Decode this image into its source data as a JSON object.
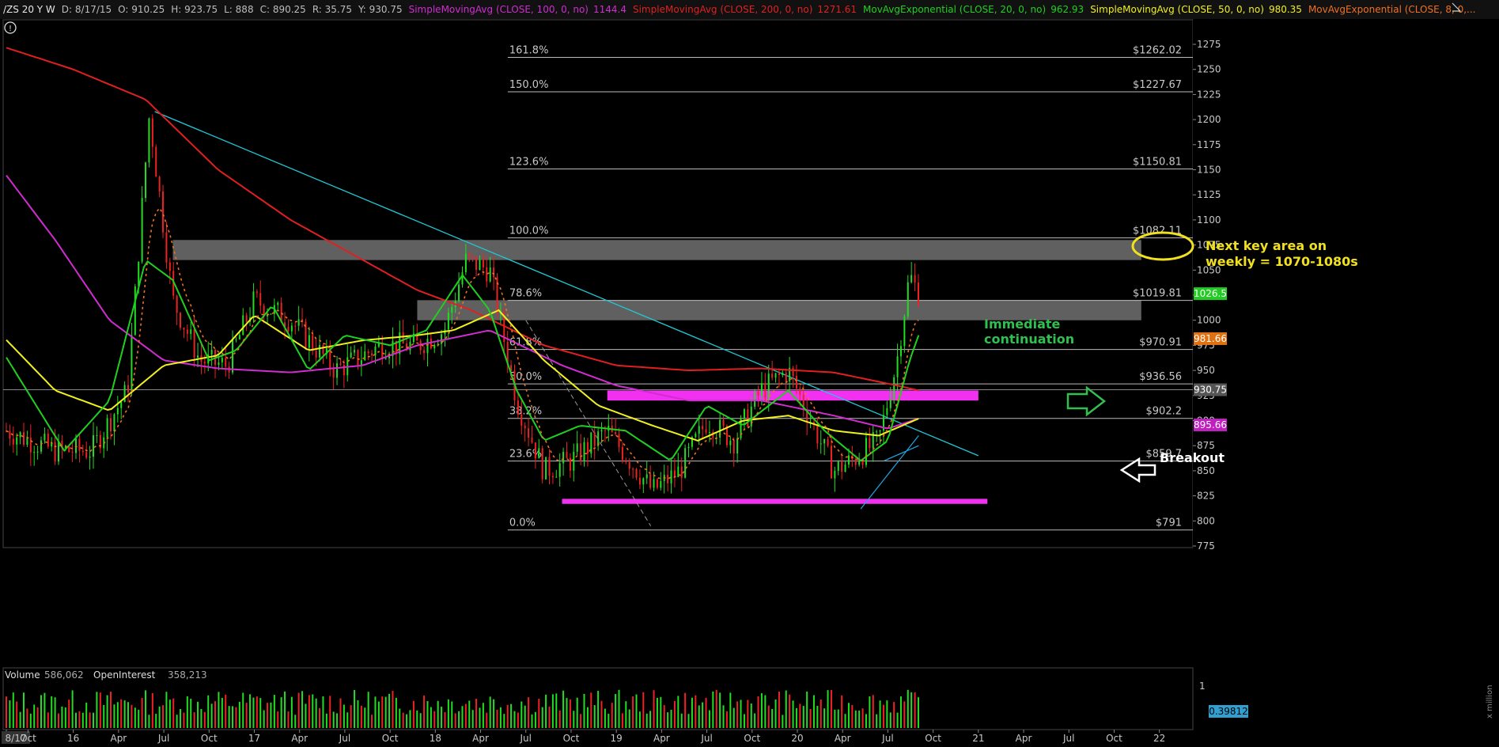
{
  "header": {
    "symbol": "/ZS 20 Y W",
    "date": "D: 8/17/15",
    "open": "O: 910.25",
    "high": "H: 923.75",
    "low": "L: 888",
    "close": "C: 890.25",
    "range": "R: 35.75",
    "ytd": "Y: 930.75",
    "studies": [
      {
        "label": "SimpleMovingAvg (CLOSE, 100, 0, no)",
        "value": "1144.4",
        "color": "#d02cd0"
      },
      {
        "label": "SimpleMovingAvg (CLOSE, 200, 0, no)",
        "value": "1271.61",
        "color": "#e02020"
      },
      {
        "label": "MovAvgExponential (CLOSE, 20, 0, no)",
        "value": "962.93",
        "color": "#20d020"
      },
      {
        "label": "SimpleMovingAvg (CLOSE, 50, 0, no)",
        "value": "980.35",
        "color": "#f0f020"
      },
      {
        "label": "MovAvgExponential (CLOSE, 8, 0,...",
        "value": "",
        "color": "#f07020"
      }
    ]
  },
  "fibs": [
    {
      "pct": "161.8%",
      "price": "$1262.02",
      "level": 1262.02
    },
    {
      "pct": "150.0%",
      "price": "$1227.67",
      "level": 1227.67
    },
    {
      "pct": "123.6%",
      "price": "$1150.81",
      "level": 1150.81
    },
    {
      "pct": "100.0%",
      "price": "$1082.11",
      "level": 1082.11
    },
    {
      "pct": "78.6%",
      "price": "$1019.81",
      "level": 1019.81
    },
    {
      "pct": "61.8%",
      "price": "$970.91",
      "level": 970.91
    },
    {
      "pct": "50.0%",
      "price": "$936.56",
      "level": 936.56
    },
    {
      "pct": "38.2%",
      "price": "$902.2",
      "level": 902.2
    },
    {
      "pct": "23.6%",
      "price": "$859.7",
      "level": 859.7
    },
    {
      "pct": "0.0%",
      "price": "$791",
      "level": 791
    }
  ],
  "annotations": {
    "next_key_line1": "Next key area on",
    "next_key_line2": "weekly = 1070-1080s",
    "immediate_line1": "Immediate",
    "immediate_line2": "continuation",
    "breakout": "Breakout"
  },
  "price_badges": [
    {
      "label": "1026.5",
      "value": 1026.5,
      "color": "#22cc22"
    },
    {
      "label": "981.66",
      "value": 981.66,
      "color": "#e07010"
    },
    {
      "label": "930.75",
      "value": 930.75,
      "color": "#555555"
    },
    {
      "label": "895.66",
      "value": 895.66,
      "color": "#c020c0"
    }
  ],
  "volume_panel": {
    "volume_label": "Volume",
    "volume_value": "586,062",
    "oi_label": "OpenInterest",
    "oi_value": "358,213",
    "badge": "0.39812",
    "scale_top": "1",
    "scale_unit": "x million"
  },
  "date_labels": [
    "8/17",
    "Oct",
    "16",
    "Apr",
    "Jul",
    "Oct",
    "17",
    "Apr",
    "Jul",
    "Oct",
    "18",
    "Apr",
    "Jul",
    "Oct",
    "19",
    "Apr",
    "Jul",
    "Oct",
    "20",
    "Apr",
    "Jul",
    "Oct",
    "21",
    "Apr",
    "Jul",
    "Oct",
    "22"
  ],
  "chart_data": {
    "type": "line",
    "title": "/ZS 20 Y W",
    "ylim": [
      775,
      1290
    ],
    "y_ticks": [
      775,
      800,
      825,
      850,
      875,
      900,
      925,
      950,
      975,
      1000,
      1025,
      1050,
      1075,
      1100,
      1125,
      1150,
      1175,
      1200,
      1225,
      1250,
      1275
    ],
    "zones": [
      {
        "name": "gray-resistance-upper",
        "from": 1060,
        "to": 1080,
        "start": 2016.55,
        "end": 2021.9,
        "color": "#808080"
      },
      {
        "name": "gray-resistance-lower",
        "from": 1000,
        "to": 1020,
        "start": 2017.9,
        "end": 2021.9,
        "color": "#808080"
      },
      {
        "name": "magenta-breakout-zone",
        "from": 920,
        "to": 930,
        "start": 2018.95,
        "end": 2021.0,
        "color": "#ff33ff"
      },
      {
        "name": "magenta-support-zone",
        "from": 817,
        "to": 822,
        "start": 2018.7,
        "end": 2021.05,
        "color": "#ff33ff"
      }
    ],
    "series": [
      {
        "name": "/ZS",
        "color": "#e02020",
        "x": [
          2015.63,
          2015.9,
          2016.1,
          2016.3,
          2016.42,
          2016.55,
          2016.7,
          2016.85,
          2017.0,
          2017.2,
          2017.45,
          2017.7,
          2017.9,
          2018.05,
          2018.17,
          2018.3,
          2018.45,
          2018.6,
          2018.75,
          2018.95,
          2019.2,
          2019.35,
          2019.5,
          2019.65,
          2019.8,
          2019.95,
          2020.05,
          2020.2,
          2020.3,
          2020.45,
          2020.55,
          2020.62,
          2020.67
        ],
        "values": [
          890,
          870,
          870,
          930,
          1205,
          1020,
          960,
          955,
          1020,
          1000,
          950,
          975,
          975,
          990,
          1060,
          1050,
          920,
          850,
          860,
          890,
          830,
          850,
          900,
          880,
          930,
          950,
          910,
          850,
          860,
          880,
          960,
          1045,
          1026.5
        ]
      },
      {
        "name": "SimpleMovingAvg (CLOSE, 200, 0, no)",
        "color": "#e02020",
        "x": [
          2015.63,
          2016.0,
          2016.4,
          2016.8,
          2017.2,
          2017.6,
          2017.9,
          2018.2,
          2018.6,
          2019.0,
          2019.4,
          2019.8,
          2020.2,
          2020.55,
          2020.67
        ],
        "values": [
          1271.61,
          1250,
          1220,
          1150,
          1100,
          1060,
          1030,
          1010,
          975,
          955,
          950,
          952,
          948,
          935,
          930
        ]
      },
      {
        "name": "SimpleMovingAvg (CLOSE, 100, 0, no)",
        "color": "#d02cd0",
        "x": [
          2015.63,
          2015.9,
          2016.2,
          2016.5,
          2016.8,
          2017.2,
          2017.6,
          2017.9,
          2018.3,
          2018.7,
          2019.0,
          2019.4,
          2019.8,
          2020.2,
          2020.5,
          2020.67
        ],
        "values": [
          1144.4,
          1080,
          1000,
          960,
          952,
          948,
          955,
          975,
          990,
          955,
          935,
          920,
          920,
          905,
          892,
          902
        ]
      },
      {
        "name": "SimpleMovingAvg (CLOSE, 50, 0, no)",
        "color": "#f0f020",
        "x": [
          2015.63,
          2015.9,
          2016.2,
          2016.5,
          2016.8,
          2017.0,
          2017.3,
          2017.6,
          2017.9,
          2018.1,
          2018.35,
          2018.6,
          2018.9,
          2019.2,
          2019.45,
          2019.7,
          2019.95,
          2020.2,
          2020.45,
          2020.67
        ],
        "values": [
          980.35,
          930,
          910,
          955,
          965,
          1005,
          970,
          980,
          985,
          990,
          1010,
          960,
          915,
          895,
          880,
          900,
          905,
          890,
          885,
          902
        ]
      },
      {
        "name": "MovAvgExponential (CLOSE, 20, 0, no)",
        "color": "#20d020",
        "x": [
          2015.63,
          2015.95,
          2016.2,
          2016.4,
          2016.55,
          2016.75,
          2016.9,
          2017.1,
          2017.3,
          2017.5,
          2017.75,
          2017.95,
          2018.15,
          2018.3,
          2018.45,
          2018.6,
          2018.8,
          2019.05,
          2019.3,
          2019.5,
          2019.7,
          2019.95,
          2020.15,
          2020.35,
          2020.5,
          2020.62,
          2020.67
        ],
        "values": [
          962.93,
          870,
          920,
          1060,
          1040,
          960,
          970,
          1015,
          950,
          985,
          975,
          990,
          1045,
          1010,
          930,
          880,
          895,
          890,
          860,
          915,
          895,
          930,
          890,
          860,
          880,
          960,
          985
        ]
      }
    ],
    "volume": {
      "unit": "x million",
      "ylim": [
        0,
        1
      ],
      "last": 0.39812
    }
  }
}
